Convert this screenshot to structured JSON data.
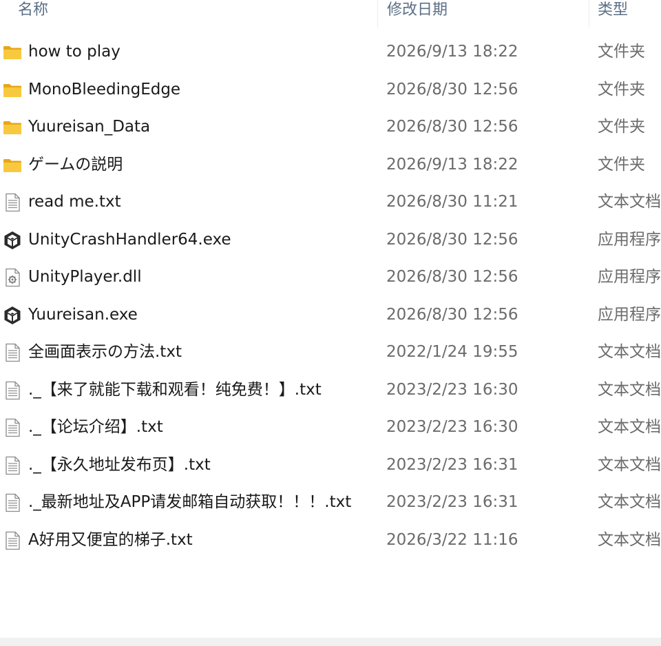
{
  "columns": {
    "name": "名称",
    "date": "修改日期",
    "type": "类型"
  },
  "files": [
    {
      "name": "how to play",
      "date": "2026/9/13 18:22",
      "type": "文件夹",
      "icon": "folder-icon"
    },
    {
      "name": "MonoBleedingEdge",
      "date": "2026/8/30 12:56",
      "type": "文件夹",
      "icon": "folder-icon"
    },
    {
      "name": "Yuureisan_Data",
      "date": "2026/8/30 12:56",
      "type": "文件夹",
      "icon": "folder-icon"
    },
    {
      "name": "ゲームの説明",
      "date": "2026/9/13 18:22",
      "type": "文件夹",
      "icon": "folder-icon"
    },
    {
      "name": "read me.txt",
      "date": "2026/8/30 11:21",
      "type": "文本文档",
      "icon": "text-file-icon"
    },
    {
      "name": "UnityCrashHandler64.exe",
      "date": "2026/8/30 12:56",
      "type": "应用程序",
      "icon": "unity-app-icon"
    },
    {
      "name": "UnityPlayer.dll",
      "date": "2026/8/30 12:56",
      "type": "应用程序",
      "icon": "dll-file-icon"
    },
    {
      "name": "Yuureisan.exe",
      "date": "2026/8/30 12:56",
      "type": "应用程序",
      "icon": "unity-app-icon"
    },
    {
      "name": "全画面表示の方法.txt",
      "date": "2022/1/24 19:55",
      "type": "文本文档",
      "icon": "text-file-icon"
    },
    {
      "name": "._【来了就能下载和观看！纯免费！】.txt",
      "date": "2023/2/23 16:30",
      "type": "文本文档",
      "icon": "text-file-icon"
    },
    {
      "name": "._【论坛介绍】.txt",
      "date": "2023/2/23 16:30",
      "type": "文本文档",
      "icon": "text-file-icon"
    },
    {
      "name": "._【永久地址发布页】.txt",
      "date": "2023/2/23 16:31",
      "type": "文本文档",
      "icon": "text-file-icon"
    },
    {
      "name": "._最新地址及APP请发邮箱自动获取！！！.txt",
      "date": "2023/2/23 16:31",
      "type": "文本文档",
      "icon": "text-file-icon"
    },
    {
      "name": "A好用又便宜的梯子.txt",
      "date": "2026/3/22 11:16",
      "type": "文本文档",
      "icon": "text-file-icon"
    }
  ],
  "colors": {
    "header_text": "#5b6f86",
    "name_text": "#1a1a1a",
    "meta_text": "#6b6b6b",
    "folder": "#f8c93f",
    "folder_dark": "#e6a817"
  }
}
